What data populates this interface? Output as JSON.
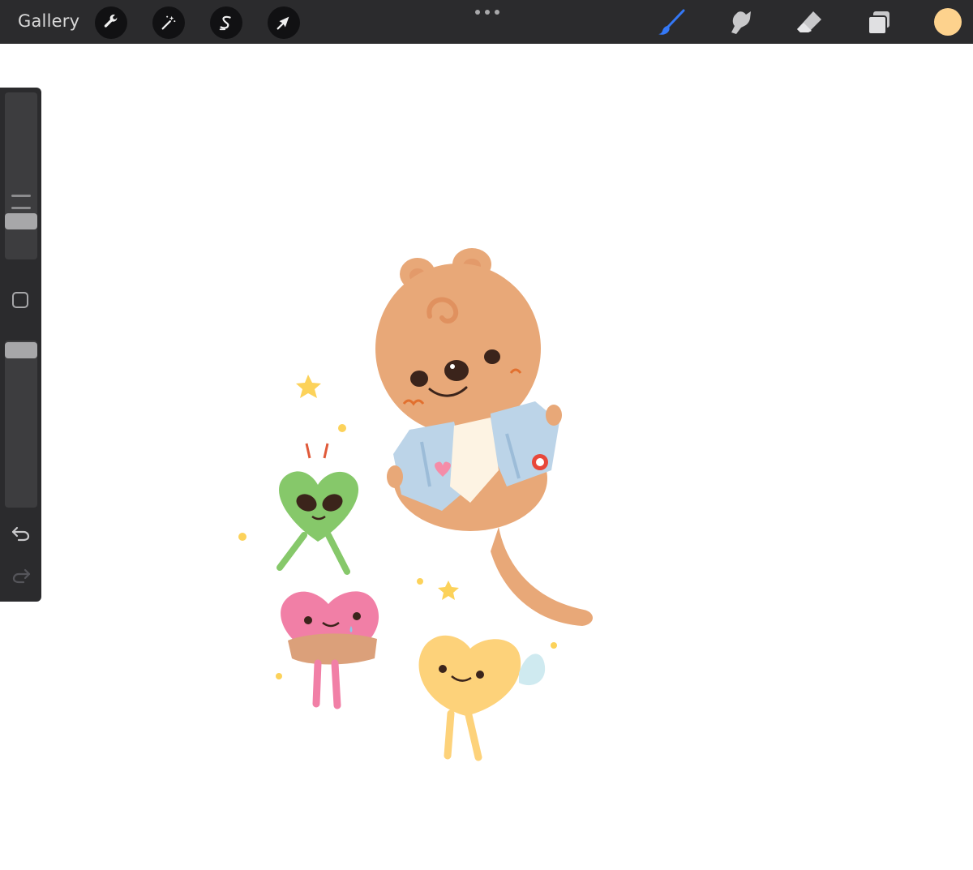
{
  "toolbar": {
    "gallery_label": "Gallery",
    "left_tools": [
      {
        "name": "actions",
        "icon": "wrench-icon"
      },
      {
        "name": "adjustments",
        "icon": "magic-wand-icon"
      },
      {
        "name": "selection",
        "icon": "selection-s-icon"
      },
      {
        "name": "transform",
        "icon": "arrow-cursor-icon"
      }
    ],
    "more_icon": "ellipsis-icon",
    "right_tools": [
      {
        "name": "brush",
        "icon": "brush-icon",
        "active": true
      },
      {
        "name": "smudge",
        "icon": "smudge-finger-icon",
        "active": false
      },
      {
        "name": "eraser",
        "icon": "eraser-icon",
        "active": false
      },
      {
        "name": "layers",
        "icon": "layers-icon",
        "active": false
      }
    ],
    "current_color": "#fdd28d",
    "active_tool_color": "#3478f6"
  },
  "sidebar": {
    "brush_size_icon": "size-slider-icon",
    "modify_icon": "square-modifier-icon",
    "opacity_icon": "opacity-slider-icon",
    "undo_icon": "undo-arrow-icon",
    "redo_icon": "redo-arrow-icon"
  },
  "canvas": {
    "background": "#ffffff",
    "artwork": {
      "description_icon": "illustration-quokka-hearts",
      "palette": {
        "quokka": "#e8a878",
        "jacket": "#bcd4e8",
        "green_heart": "#86c86a",
        "pink_heart": "#f17fa6",
        "yellow_heart": "#fdd27a",
        "stars": "#fcd25a"
      }
    }
  }
}
